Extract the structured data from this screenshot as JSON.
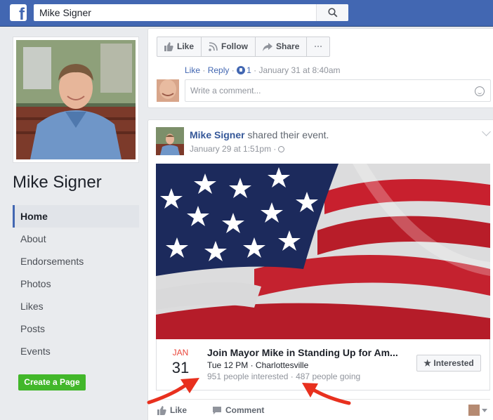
{
  "search": {
    "value": "Mike Signer"
  },
  "brand": {
    "logo_letter": "f"
  },
  "page": {
    "name": "Mike Signer"
  },
  "nav": {
    "items": [
      "Home",
      "About",
      "Endorsements",
      "Photos",
      "Likes",
      "Posts",
      "Events"
    ]
  },
  "create_page_label": "Create a Page",
  "actions": {
    "like": "Like",
    "follow": "Follow",
    "share": "Share",
    "more": "···"
  },
  "comment_meta": {
    "like": "Like",
    "reply": "Reply",
    "reaction_count": "1",
    "sep": "·",
    "time": "January 31 at 8:40am"
  },
  "comment_placeholder": "Write a comment...",
  "post": {
    "author": "Mike Signer",
    "action_text": "shared their event.",
    "time": "January 29 at 1:51pm ·"
  },
  "event": {
    "month": "JAN",
    "day": "31",
    "title": "Join Mayor Mike in Standing Up for Am...",
    "when_where": "Tue 12 PM · Charlottesville",
    "stats": "951 people interested · 487 people going",
    "interested_label": "★ Interested"
  },
  "post_actions": {
    "like": "Like",
    "comment": "Comment"
  },
  "colors": {
    "fb_blue": "#4267b2",
    "green": "#42b72a",
    "arrow_red": "#e8301e"
  }
}
